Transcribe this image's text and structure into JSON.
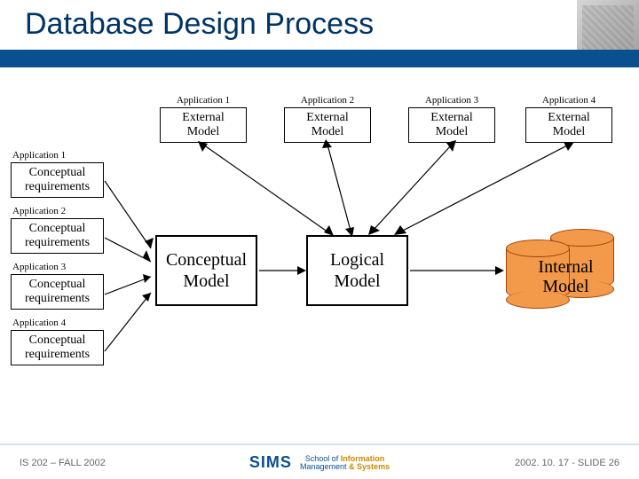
{
  "header": {
    "title": "Database Design Process"
  },
  "external_models": [
    {
      "app_label": "Application 1",
      "line1": "External",
      "line2": "Model"
    },
    {
      "app_label": "Application 2",
      "line1": "External",
      "line2": "Model"
    },
    {
      "app_label": "Application 3",
      "line1": "External",
      "line2": "Model"
    },
    {
      "app_label": "Application 4",
      "line1": "External",
      "line2": "Model"
    }
  ],
  "requirements": [
    {
      "app_label": "Application 1",
      "line1": "Conceptual",
      "line2": "requirements"
    },
    {
      "app_label": "Application 2",
      "line1": "Conceptual",
      "line2": "requirements"
    },
    {
      "app_label": "Application 3",
      "line1": "Conceptual",
      "line2": "requirements"
    },
    {
      "app_label": "Application 4",
      "line1": "Conceptual",
      "line2": "requirements"
    }
  ],
  "models": {
    "conceptual": {
      "line1": "Conceptual",
      "line2": "Model"
    },
    "logical": {
      "line1": "Logical",
      "line2": "Model"
    },
    "internal": {
      "line1": "Internal",
      "line2": "Model"
    }
  },
  "footer": {
    "left": "IS 202 – FALL 2002",
    "right": "2002. 10. 17 - SLIDE 26",
    "logo_main": "SIMS",
    "logo_sub1": "School of",
    "logo_sub2_a": "Information",
    "logo_sub2_b": "Management",
    "logo_sub2_c": "& Systems"
  }
}
